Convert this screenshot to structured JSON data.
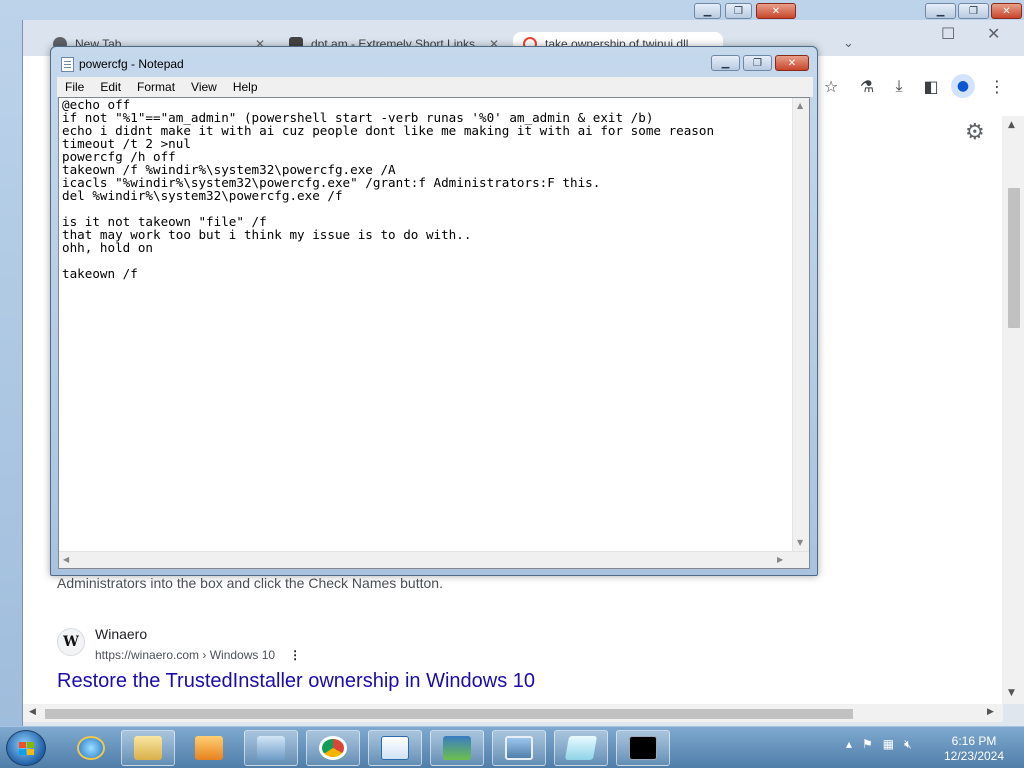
{
  "browser": {
    "tabs": [
      {
        "label": "New Tab",
        "active": false
      },
      {
        "label": "dpt.am - Extremely Short Links",
        "active": false
      },
      {
        "label": "take ownership of twinui.dll",
        "active": true
      }
    ],
    "toolbar_icons": [
      "bookmark-star-icon",
      "experiments-icon",
      "download-icon",
      "side-panel-icon",
      "profile-icon",
      "menu-icon"
    ]
  },
  "page": {
    "snippet": "Administrators into the box and click the Check Names button.",
    "result": {
      "favicon_letter": "W",
      "site_name": "Winaero",
      "url": "https://winaero.com › Windows 10",
      "more": "⋮",
      "title": "Restore the TrustedInstaller ownership in Windows 10"
    }
  },
  "notepad": {
    "title": "powercfg - Notepad",
    "menu": [
      "File",
      "Edit",
      "Format",
      "View",
      "Help"
    ],
    "content": "@echo off\nif not \"%1\"==\"am_admin\" (powershell start -verb runas '%0' am_admin & exit /b)\necho i didnt make it with ai cuz people dont like me making it with ai for some reason\ntimeout /t 2 >nul\npowercfg /h off\ntakeown /f %windir%\\system32\\powercfg.exe /A\nicacls \"%windir%\\system32\\powercfg.exe\" /grant:f Administrators:F this.\ndel %windir%\\system32\\powercfg.exe /f\n\nis it not takeown \"file\" /f\nthat may work too but i think my issue is to do with..\nohh, hold on\n\ntakeown /f"
  },
  "taskbar": {
    "time": "6:16 PM",
    "date": "12/23/2024"
  },
  "colors": {
    "link": "#1a0dab",
    "taskbar": "#4f7ea9"
  }
}
